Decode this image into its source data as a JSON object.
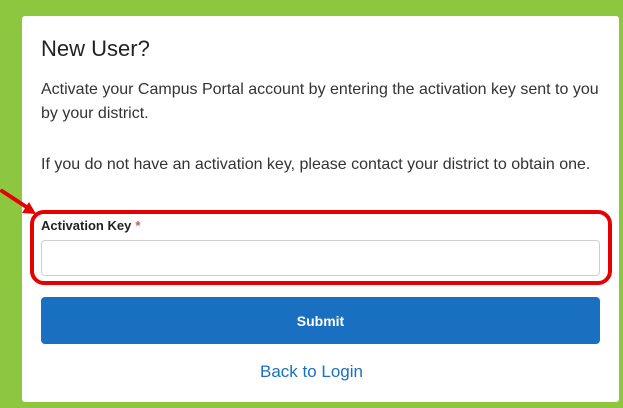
{
  "card": {
    "title": "New User?",
    "paragraph_1": "Activate your Campus Portal account by entering the activation key sent to you by your district.",
    "paragraph_2": "If you do not have an activation key, please contact your district to obtain one."
  },
  "activation_key": {
    "label": "Activation Key",
    "required_mark": "*",
    "value": "",
    "placeholder": ""
  },
  "submit": {
    "label": "Submit"
  },
  "back_link": {
    "label": "Back to Login"
  },
  "colors": {
    "frame_green": "#8dc63f",
    "highlight_red": "#e60000",
    "primary_blue": "#1a70c0"
  }
}
